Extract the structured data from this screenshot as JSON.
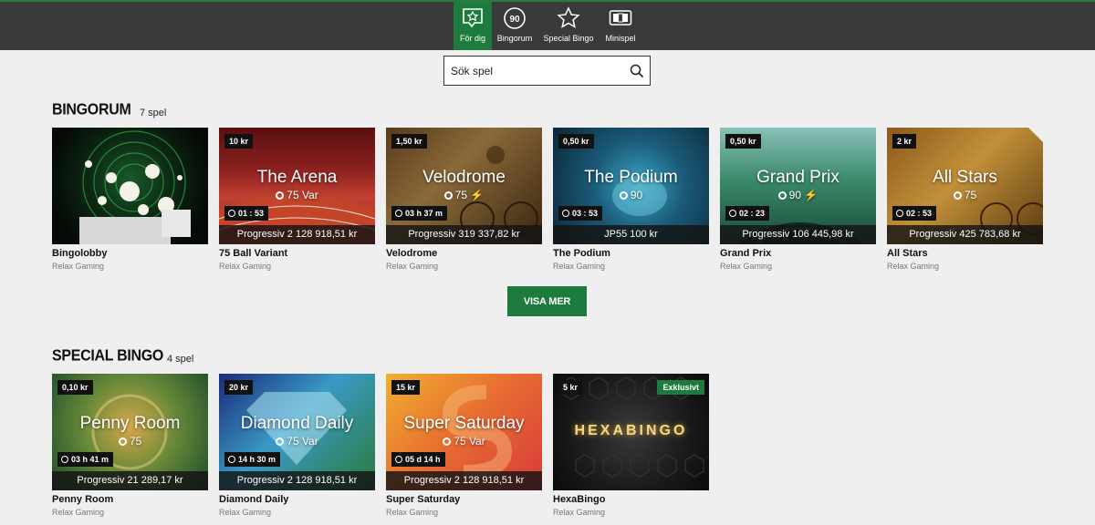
{
  "nav": {
    "items": [
      {
        "label": "För dig",
        "icon": "star-speech-icon",
        "active": true
      },
      {
        "label": "Bingorum",
        "icon": "ball-90-icon",
        "active": false,
        "badge": "90"
      },
      {
        "label": "Special Bingo",
        "icon": "star-outline-icon",
        "active": false
      },
      {
        "label": "Minispel",
        "icon": "minigames-icon",
        "active": false
      }
    ]
  },
  "search": {
    "placeholder": "Sök spel",
    "icon": "search-icon"
  },
  "bingorum": {
    "title": "BINGORUM",
    "count": "7 spel",
    "cards": [
      {
        "name": "Bingolobby",
        "provider": "Relax Gaming"
      },
      {
        "name": "75 Ball Variant",
        "provider": "Relax Gaming",
        "price": "10 kr",
        "title": "The Arena",
        "sub": "75 Var",
        "timer": "01 : 53",
        "progressive": "Progressiv 2 128 918,51 kr"
      },
      {
        "name": "Velodrome",
        "provider": "Relax Gaming",
        "price": "1,50 kr",
        "title": "Velodrome",
        "sub": "75",
        "timer": "03 h 37 m",
        "progressive": "Progressiv 319 337,82 kr"
      },
      {
        "name": "The Podium",
        "provider": "Relax Gaming",
        "price": "0,50 kr",
        "title": "The Podium",
        "sub": "90",
        "timer": "03 : 53",
        "progressive": "JP55 100 kr"
      },
      {
        "name": "Grand Prix",
        "provider": "Relax Gaming",
        "price": "0,50 kr",
        "title": "Grand Prix",
        "sub": "90",
        "timer": "02 : 23",
        "progressive": "Progressiv 106 445,98 kr"
      },
      {
        "name": "All Stars",
        "provider": "Relax Gaming",
        "price": "2 kr",
        "title": "All Stars",
        "sub": "75",
        "timer": "02 : 53",
        "progressive": "Progressiv 425 783,68 kr"
      }
    ],
    "more_label": "VISA MER"
  },
  "special": {
    "title": "SPECIAL BINGO",
    "count": "4 spel",
    "cards": [
      {
        "name": "Penny Room",
        "provider": "Relax Gaming",
        "price": "0,10 kr",
        "title": "Penny Room",
        "sub": "75",
        "timer": "03 h 41 m",
        "progressive": "Progressiv 21 289,17 kr"
      },
      {
        "name": "Diamond Daily",
        "provider": "Relax Gaming",
        "price": "20 kr",
        "title": "Diamond Daily",
        "sub": "75 Var",
        "timer": "14 h 30 m",
        "progressive": "Progressiv 2 128 918,51 kr"
      },
      {
        "name": "Super Saturday",
        "provider": "Relax Gaming",
        "price": "15 kr",
        "title": "Super Saturday",
        "sub": "75 Var",
        "timer": "05 d 14 h",
        "progressive": "Progressiv 2 128 918,51 kr"
      },
      {
        "name": "HexaBingo",
        "provider": "Relax Gaming",
        "price": "5 kr",
        "badge": "Exklusivt",
        "logo": "HEXABINGO"
      }
    ]
  },
  "colors": {
    "accent": "#1d7c3d",
    "nav_bg": "#3a3a3a",
    "page_bg": "#efefef"
  }
}
